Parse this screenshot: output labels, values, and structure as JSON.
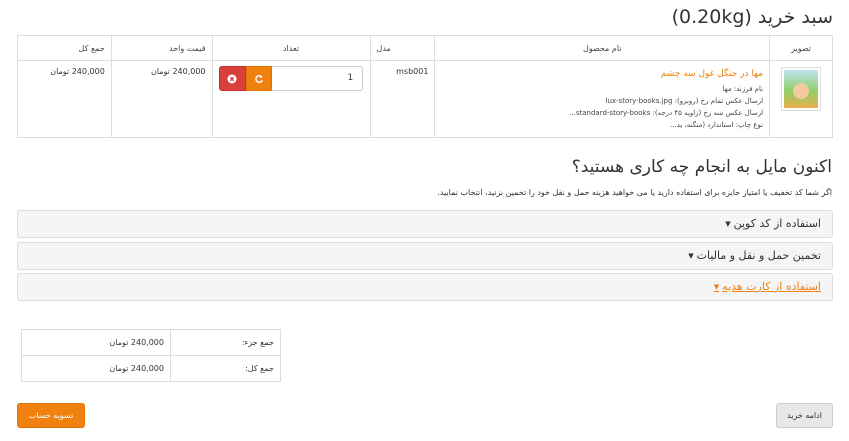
{
  "header": {
    "title": "سبد خرید  (0.20kg)"
  },
  "cart": {
    "columns": {
      "image": "تصویر",
      "name": "نام محصول",
      "model": "مدل",
      "quantity": "تعداد",
      "unit_price": "قیمت واحد",
      "total": "جمع کل"
    },
    "rows": [
      {
        "name": "مها در جنگل غول سه چشم",
        "options": [
          "نام فرزند: مها",
          "ارسال عکس تمام رخ (روبرو): lux-story-books.jpg",
          "ارسال عکس سه رخ (زاویه ۴۵ درجه): standard-story-books...",
          "نوع چاپ: استاندارد (منگنه، ید..."
        ],
        "model": "msb001",
        "quantity": "1",
        "unit_price": "240,000 تومان",
        "total": "240,000 تومان"
      }
    ],
    "icons": {
      "remove": "times-circle-icon",
      "update": "refresh-icon",
      "thumbnail": "book-cover-image"
    }
  },
  "next_steps": {
    "title": "اکنون مایل به انجام چه کاری هستید؟",
    "description": "اگر شما کد تخفیف یا امتیاز جایزه برای استفاده دارید یا می خواهید هزینه حمل و نقل خود را تخمین بزنید، انتخاب نمایید.",
    "panels": [
      {
        "label": "استفاده از کد کوپن"
      },
      {
        "label": "تخمین حمل و نقل و مالیات"
      },
      {
        "label": "استفاده از کارت هدیه"
      }
    ]
  },
  "totals": [
    {
      "label": "جمع جزء:",
      "value": "240,000 تومان"
    },
    {
      "label": "جمع کل:",
      "value": "240,000 تومان"
    }
  ],
  "actions": {
    "checkout": "تسویه حساب",
    "continue": "ادامه خرید"
  },
  "colors": {
    "accent": "#f0810f",
    "danger": "#d9403a",
    "border": "#dddddd"
  }
}
